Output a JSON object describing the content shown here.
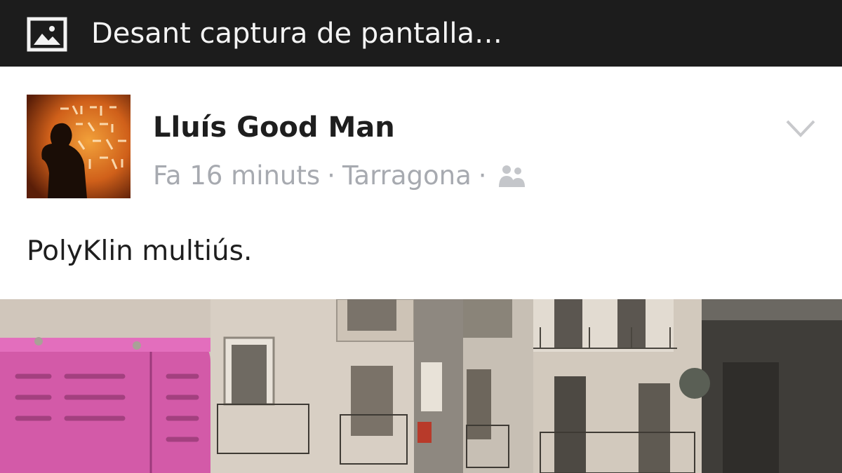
{
  "status_bar": {
    "icon": "image-icon",
    "notification_text": "Desant captura de pantalla…"
  },
  "post": {
    "author_name": "Lluís Good Man",
    "time": "Fa 16 minuts",
    "separator": "·",
    "location": "Tarragona",
    "audience_icon": "friends-icon",
    "menu_icon": "chevron-down-icon",
    "text": "PolyKlin multiús.",
    "avatar_text": "SUERTE LA FOWER SON BIEN",
    "photo_icon": "street-photo"
  },
  "colors": {
    "status_bar_bg": "#1c1c1c",
    "meta_gray": "#a7aab0",
    "text_dark": "#1e1e1e",
    "truck_pink": "#d35aa8"
  }
}
